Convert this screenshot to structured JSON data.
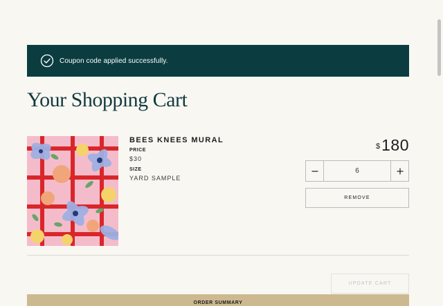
{
  "notice": {
    "message": "Coupon code applied successfully.",
    "icon": "check-circle-icon"
  },
  "cart": {
    "title": "Your Shopping Cart",
    "item": {
      "name": "BEES KNEES MURAL",
      "price_label": "PRICE",
      "price": "$30",
      "size_label": "SIZE",
      "size": "YARD SAMPLE",
      "total_currency": "$",
      "total_amount": "180",
      "quantity": "6",
      "remove_label": "REMOVE"
    },
    "update_label": "UPDATE CART"
  },
  "order_summary": {
    "label": "ORDER SUMMARY"
  },
  "colors": {
    "notice_bg": "#0b3d40",
    "title": "#143b3f",
    "summary_bg": "#cdb98f",
    "page_bg": "#f8f7f2"
  }
}
